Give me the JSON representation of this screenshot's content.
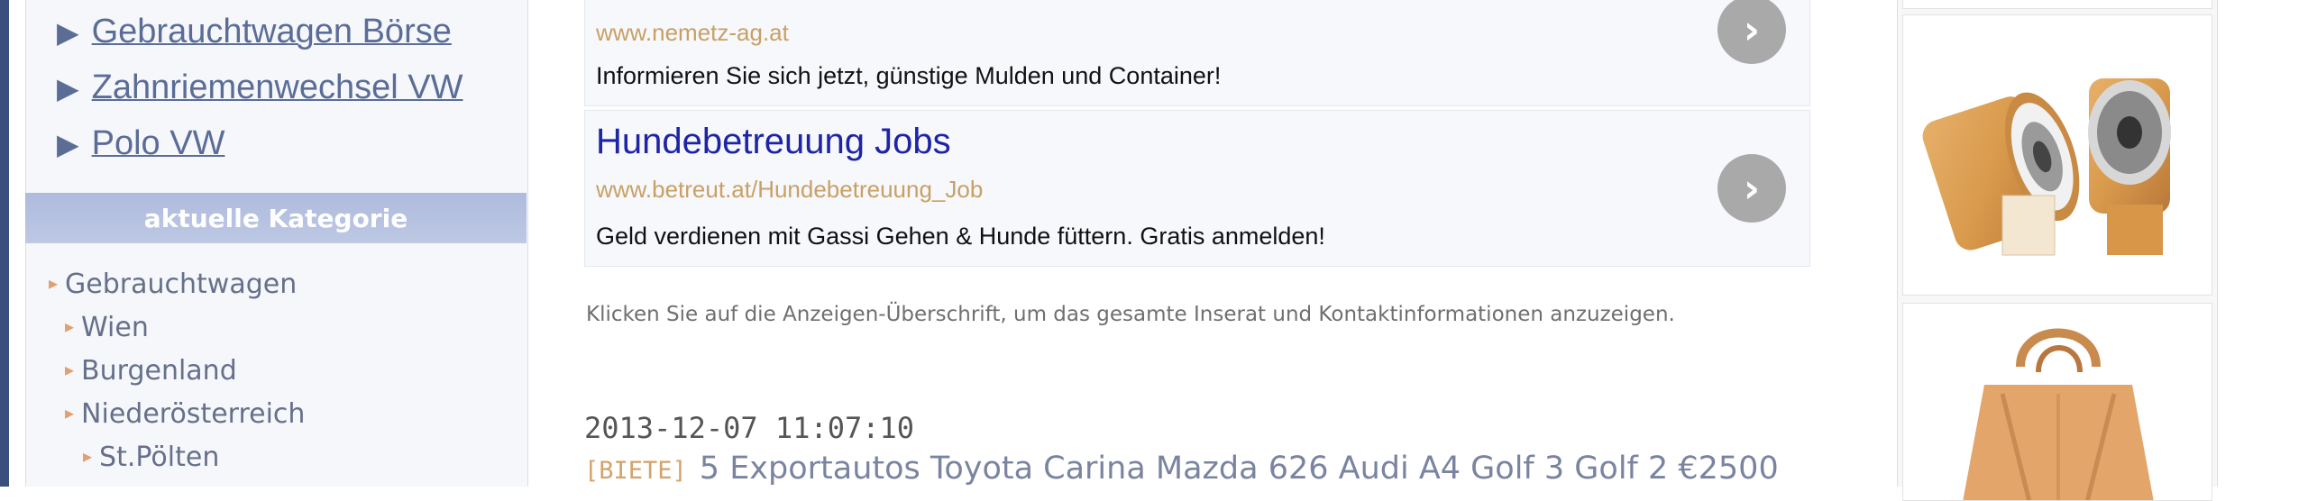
{
  "sidebar": {
    "related_links": [
      {
        "label": "Gebrauchtwagen Börse"
      },
      {
        "label": "Zahnriemenwechsel VW"
      },
      {
        "label": "Polo VW"
      }
    ],
    "category_header": "aktuelle Kategorie",
    "categories": [
      {
        "label": "Gebrauchtwagen",
        "level": 0
      },
      {
        "label": "Wien",
        "level": 1
      },
      {
        "label": "Burgenland",
        "level": 1
      },
      {
        "label": "Niederösterreich",
        "level": 1
      },
      {
        "label": "St.Pölten",
        "level": 2
      }
    ]
  },
  "ads": [
    {
      "title": "",
      "url": "www.nemetz-ag.at",
      "description": "Informieren Sie sich jetzt, günstige Mulden und Container!"
    },
    {
      "title": "Hundebetreuung Jobs",
      "url": "www.betreut.at/Hundebetreuung_Job",
      "description": "Geld verdienen mit Gassi Gehen & Hunde füttern. Gratis anmelden!"
    }
  ],
  "hint_text": "Klicken Sie auf die Anzeigen-Überschrift, um das gesamte Inserat und Kontaktinformationen anzuzeigen.",
  "listing": {
    "date": "2013-12-07 11:07:10",
    "tag": "[BIETE]",
    "title": "5 Exportautos Toyota Carina Mazda 626 Audi A4 Golf 3 Golf 2 €2500"
  },
  "icons": {
    "ad_arrow": "chevron-right-icon",
    "link_arrow": "triangle-right-icon",
    "category_bullet": "small-triangle-bullet-icon"
  },
  "colors": {
    "link": "#5b6d97",
    "ad_title": "#1d24a6",
    "ad_url": "#c9a064",
    "category_header_bg": "#b4c1df",
    "tag": "#d2a36a"
  }
}
